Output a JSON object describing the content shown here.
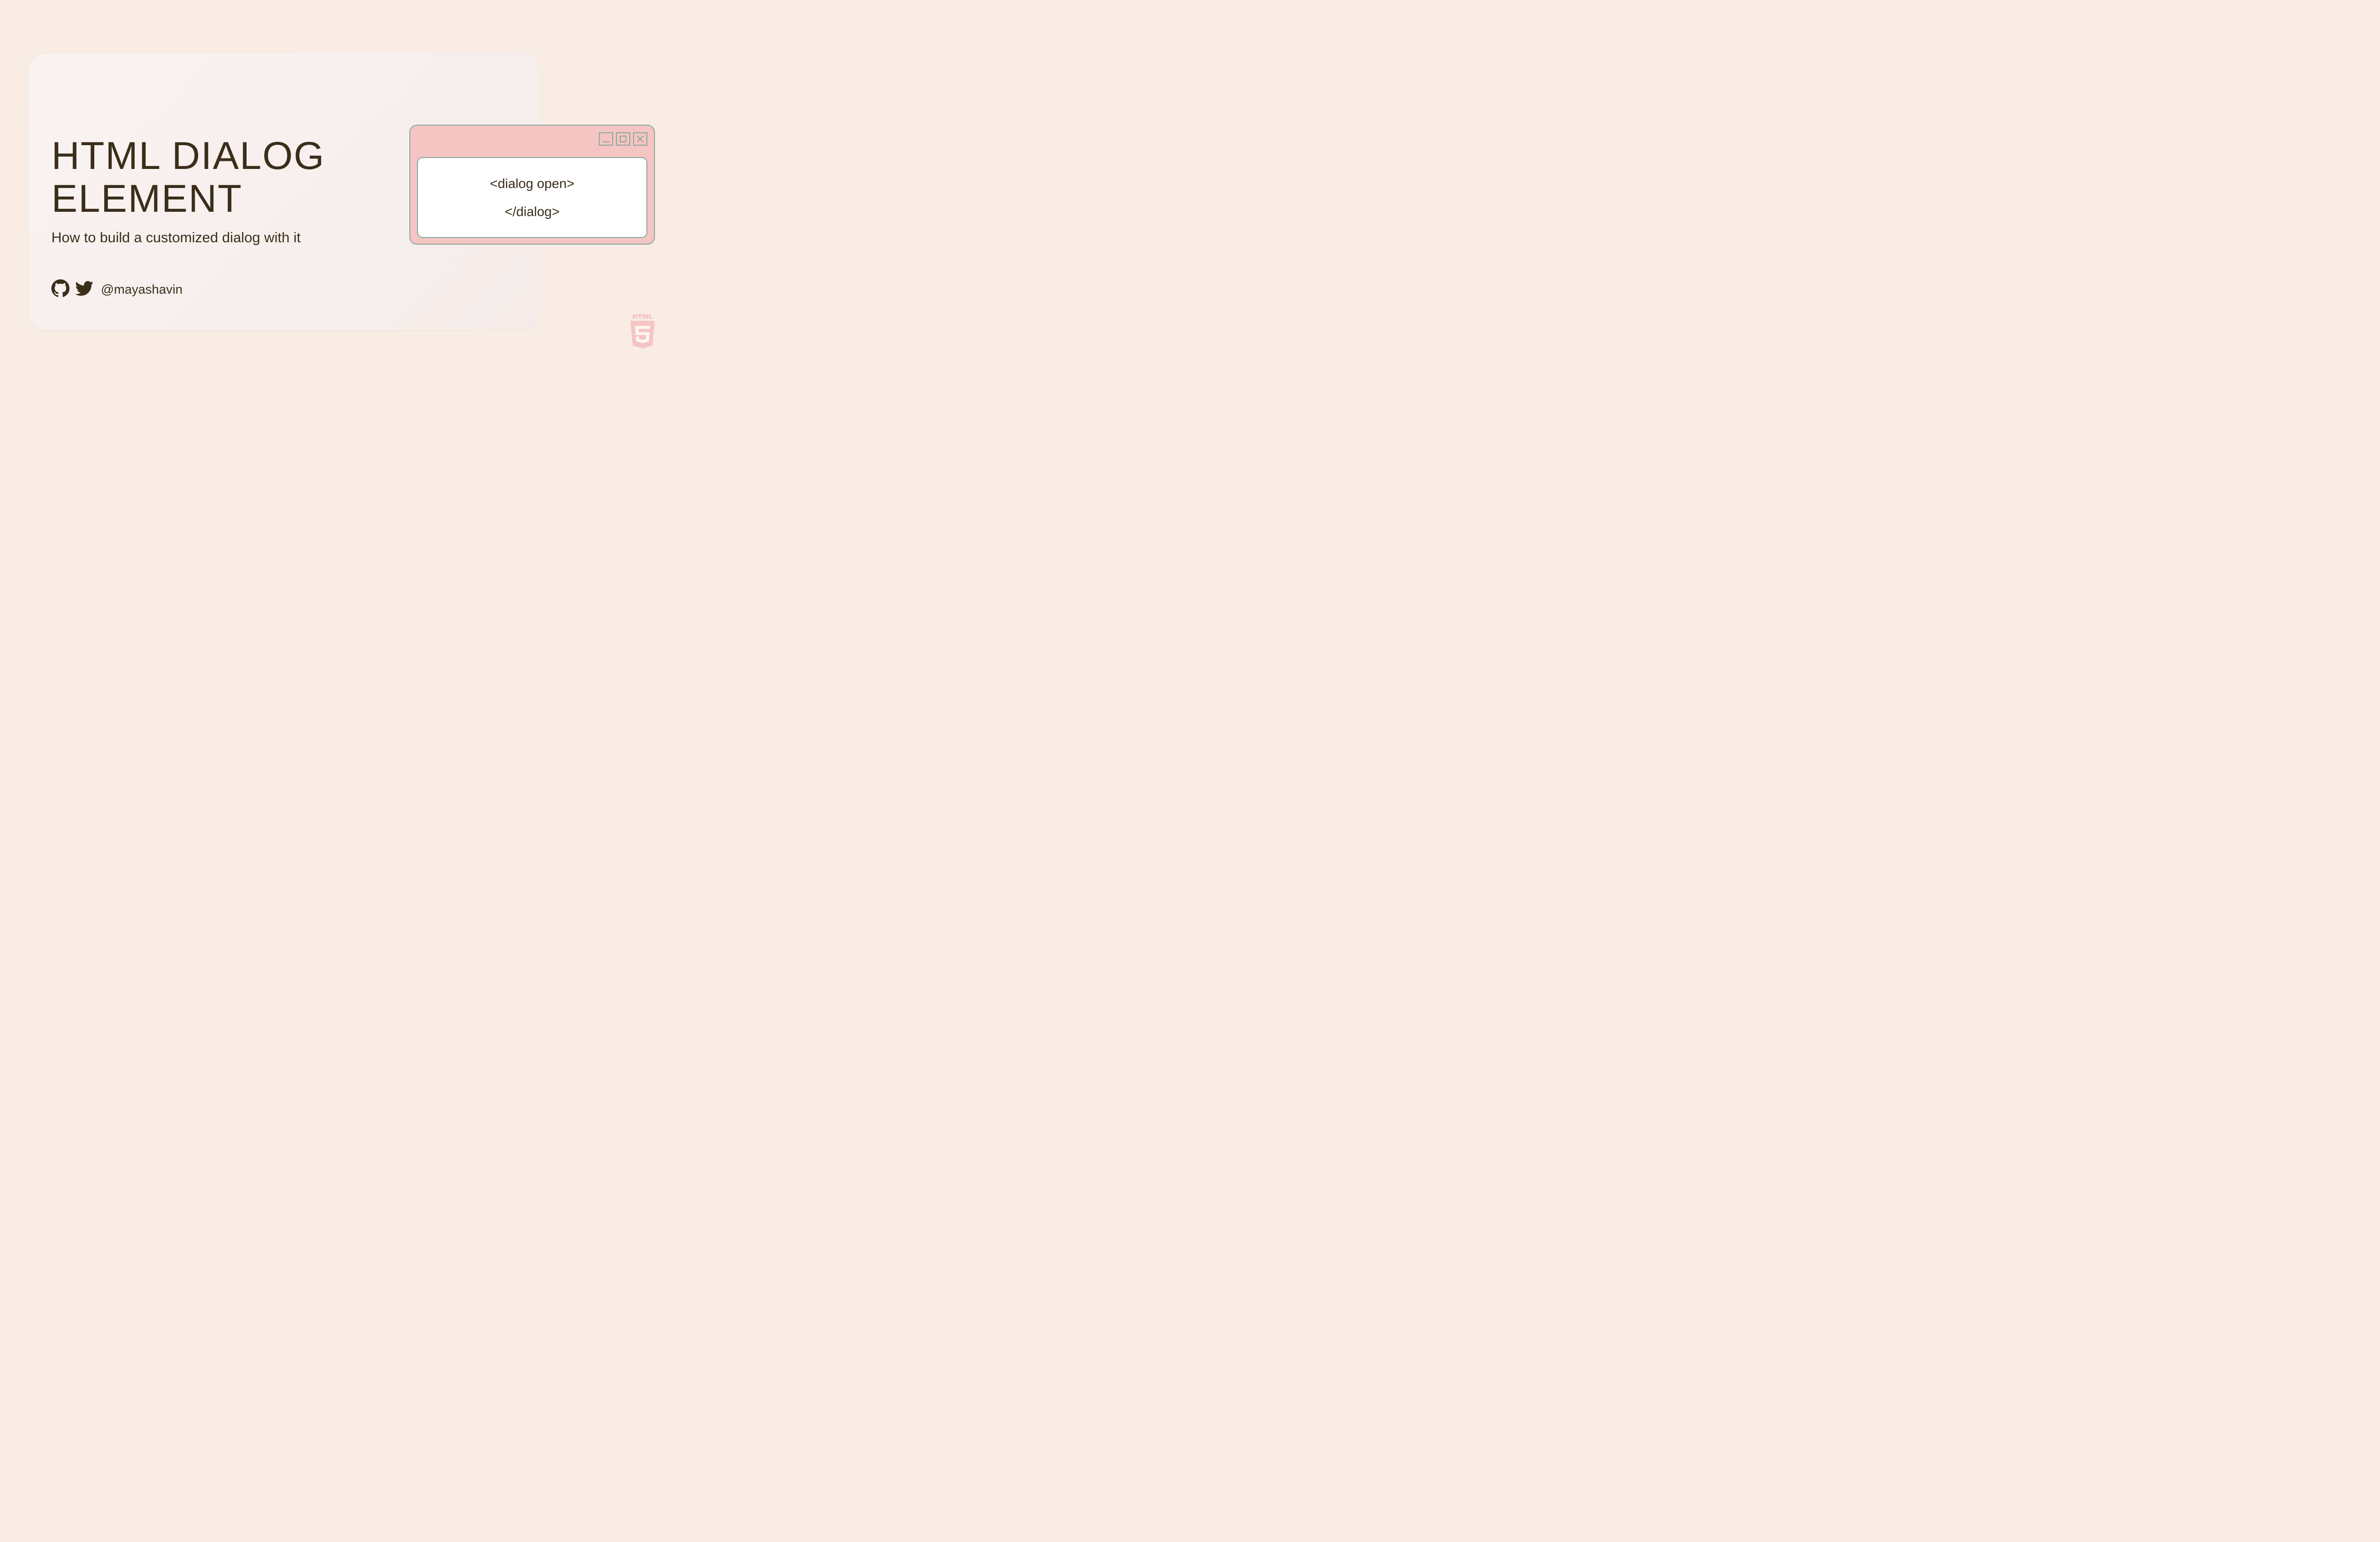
{
  "title_line1": "HTML DIALOG",
  "title_line2": "ELEMENT",
  "subtitle": "How to build a customized dialog with it",
  "social": {
    "handle": "@mayashavin"
  },
  "dialog": {
    "code_open": "<dialog open>",
    "code_close": "</dialog>"
  }
}
